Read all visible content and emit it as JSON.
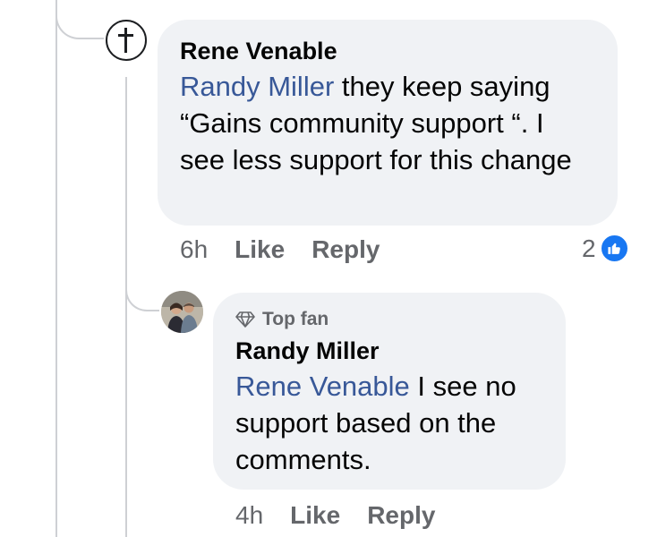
{
  "comment": {
    "author": "Rene Venable",
    "mention": "Randy Miller",
    "text": " they keep saying “Gains community support “. I see less support for this change",
    "time": "6h",
    "like_label": "Like",
    "reply_label": "Reply",
    "reaction_count": "2",
    "avatar_icon": "cross-icon"
  },
  "reply": {
    "badge_label": "Top fan",
    "badge_icon": "diamond-icon",
    "author": "Randy Miller",
    "mention": "Rene Venable",
    "text": " I see no support based on the comments.",
    "time": "4h",
    "like_label": "Like",
    "reply_label": "Reply"
  },
  "colors": {
    "mention": "#385898",
    "bubble": "#f0f2f5",
    "meta": "#65676b",
    "like_badge": "#1877f2",
    "thread_line": "#ced0d4"
  }
}
